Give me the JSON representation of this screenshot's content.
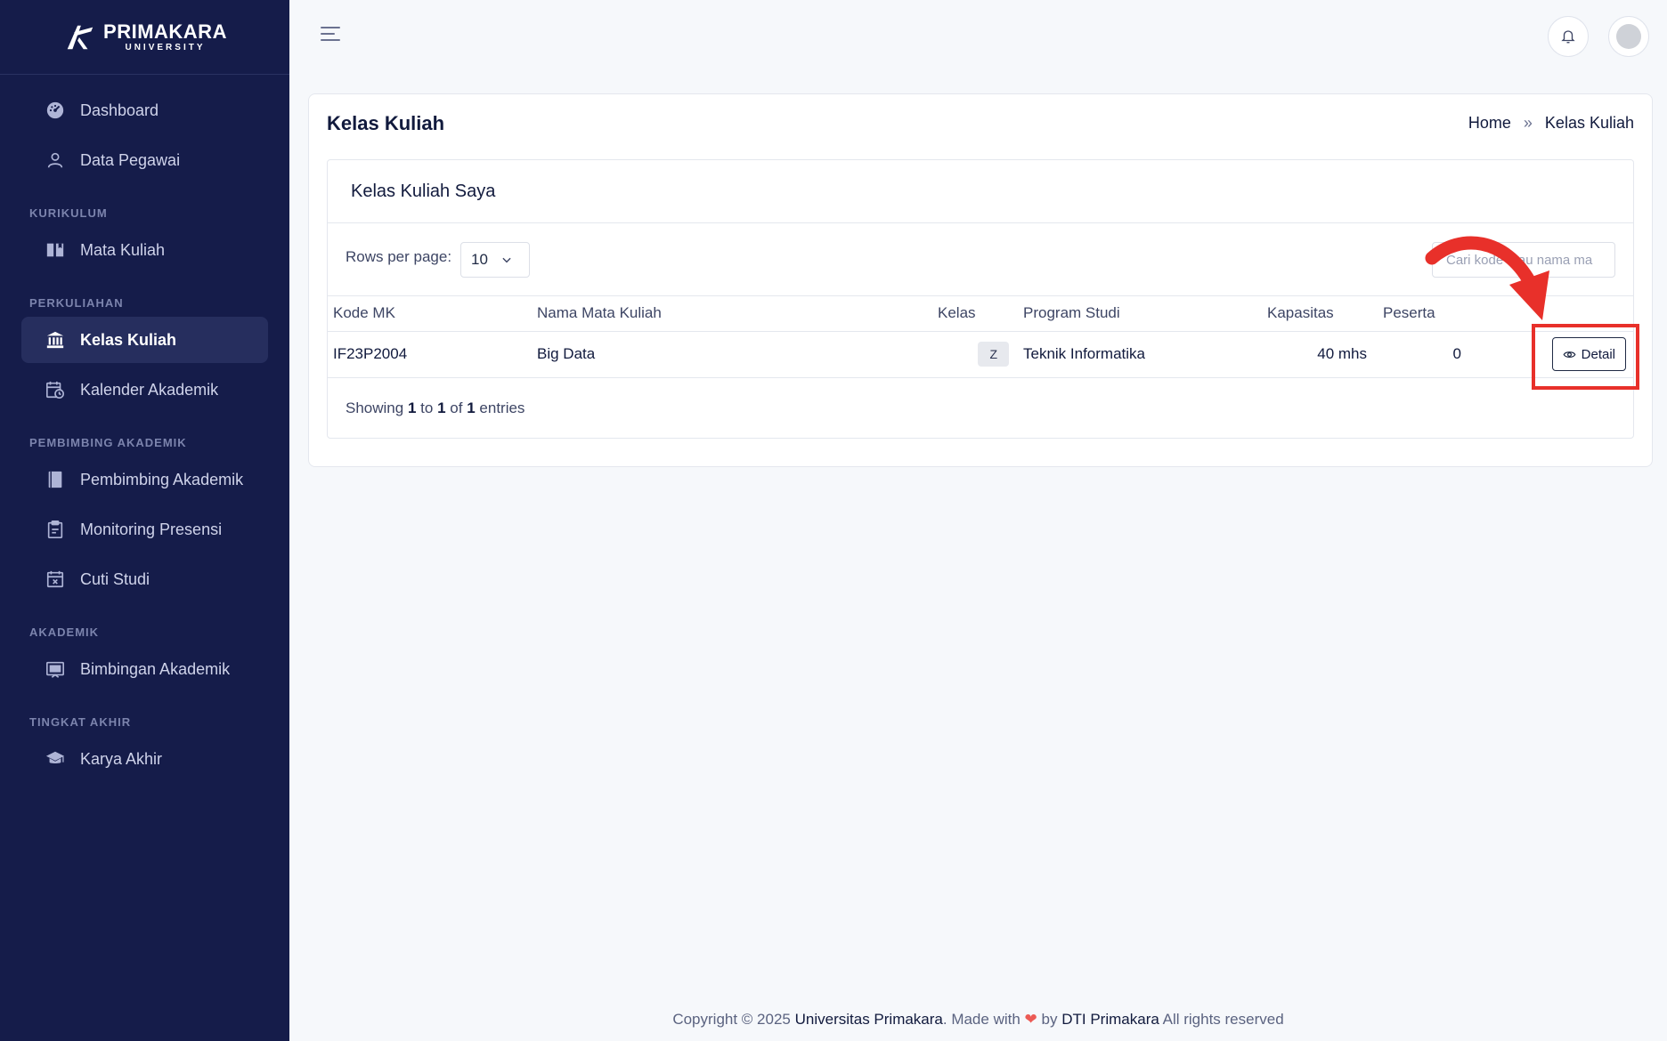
{
  "brand": {
    "name": "PRIMAKARA",
    "sub": "UNIVERSITY"
  },
  "sidebar": {
    "items": [
      {
        "label": "Dashboard"
      },
      {
        "label": "Data Pegawai"
      }
    ],
    "sections": [
      {
        "title": "KURIKULUM",
        "items": [
          {
            "label": "Mata Kuliah"
          }
        ]
      },
      {
        "title": "PERKULIAHAN",
        "items": [
          {
            "label": "Kelas Kuliah"
          },
          {
            "label": "Kalender Akademik"
          }
        ]
      },
      {
        "title": "PEMBIMBING AKADEMIK",
        "items": [
          {
            "label": "Pembimbing Akademik"
          },
          {
            "label": "Monitoring Presensi"
          },
          {
            "label": "Cuti Studi"
          }
        ]
      },
      {
        "title": "AKADEMIK",
        "items": [
          {
            "label": "Bimbingan Akademik"
          }
        ]
      },
      {
        "title": "TINGKAT AKHIR",
        "items": [
          {
            "label": "Karya Akhir"
          }
        ]
      }
    ],
    "active": "Kelas Kuliah"
  },
  "page": {
    "title": "Kelas Kuliah",
    "breadcrumb": {
      "home": "Home",
      "separator": "»",
      "current": "Kelas Kuliah"
    }
  },
  "card": {
    "title": "Kelas Kuliah Saya",
    "rows_label": "Rows per page:",
    "rows_value": "10",
    "search_placeholder": "Cari kode atau nama ma"
  },
  "table": {
    "headers": [
      "Kode MK",
      "Nama Mata Kuliah",
      "Kelas",
      "Program Studi",
      "Kapasitas",
      "Peserta"
    ],
    "rows": [
      {
        "kode": "IF23P2004",
        "nama": "Big Data",
        "kelas": "Z",
        "prodi": "Teknik Informatika",
        "kapasitas": "40 mhs",
        "peserta": "0",
        "action": "Detail"
      }
    ]
  },
  "pagination": {
    "showing": "Showing",
    "from": "1",
    "to_word": "to",
    "to": "1",
    "of_word": "of",
    "total": "1",
    "entries": "entries"
  },
  "footer": {
    "prefix": "Copyright © 2025",
    "org": "Universitas Primakara",
    "made": ". Made with",
    "by": "by",
    "team": "DTI Primakara",
    "suffix": "All rights reserved"
  },
  "colors": {
    "sidebar": "#151c4a",
    "accent_annotation": "#e8302a",
    "heart": "#ec5b55"
  }
}
